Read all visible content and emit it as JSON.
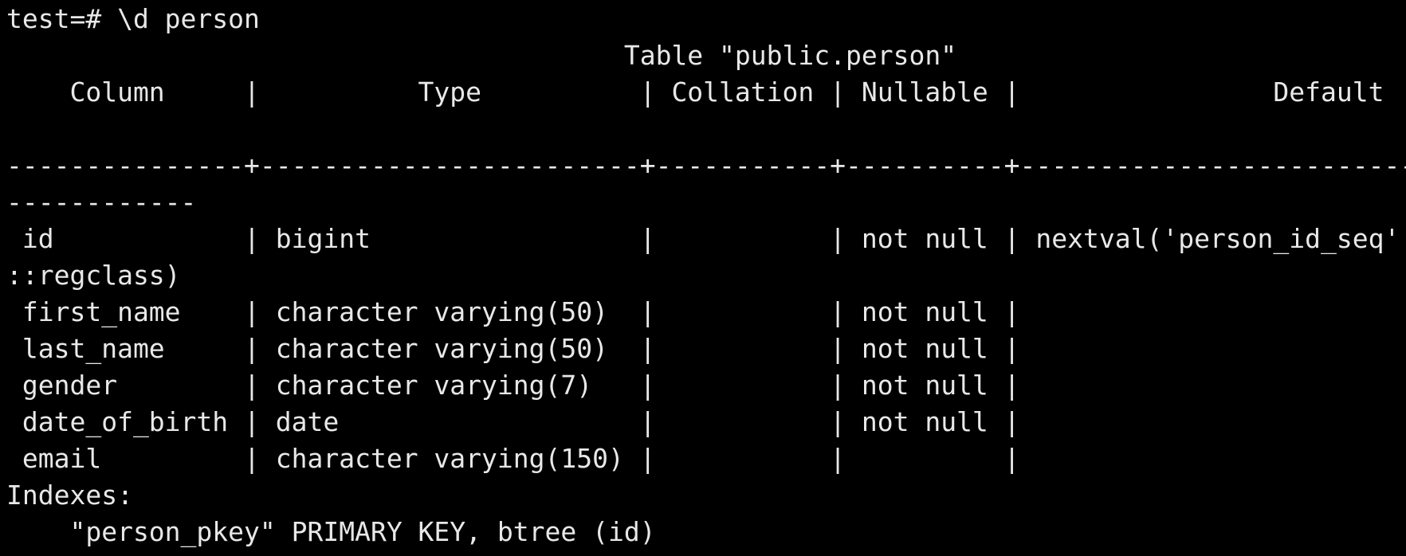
{
  "terminal": {
    "colors": {
      "background": "#000000",
      "foreground": "#e8e8e8"
    },
    "prompt_line": "test=# \\d person",
    "table_title": "                                       Table \"public.person\"",
    "header_row": "    Column     |          Type          | Collation | Nullable |                Default",
    "blank_line": "",
    "separator": "---------------+------------------------+-----------+----------+-------------------------",
    "separator_wrap": "------------",
    "rows": [
      " id            | bigint                 |           | not null | nextval('person_id_seq'",
      "::regclass)",
      " first_name    | character varying(50)  |           | not null |",
      " last_name     | character varying(50)  |           | not null |",
      " gender        | character varying(7)   |           | not null |",
      " date_of_birth | date                   |           | not null |",
      " email         | character varying(150) |           |          |"
    ],
    "indexes_label": "Indexes:",
    "index_entry": "    \"person_pkey\" PRIMARY KEY, btree (id)"
  }
}
